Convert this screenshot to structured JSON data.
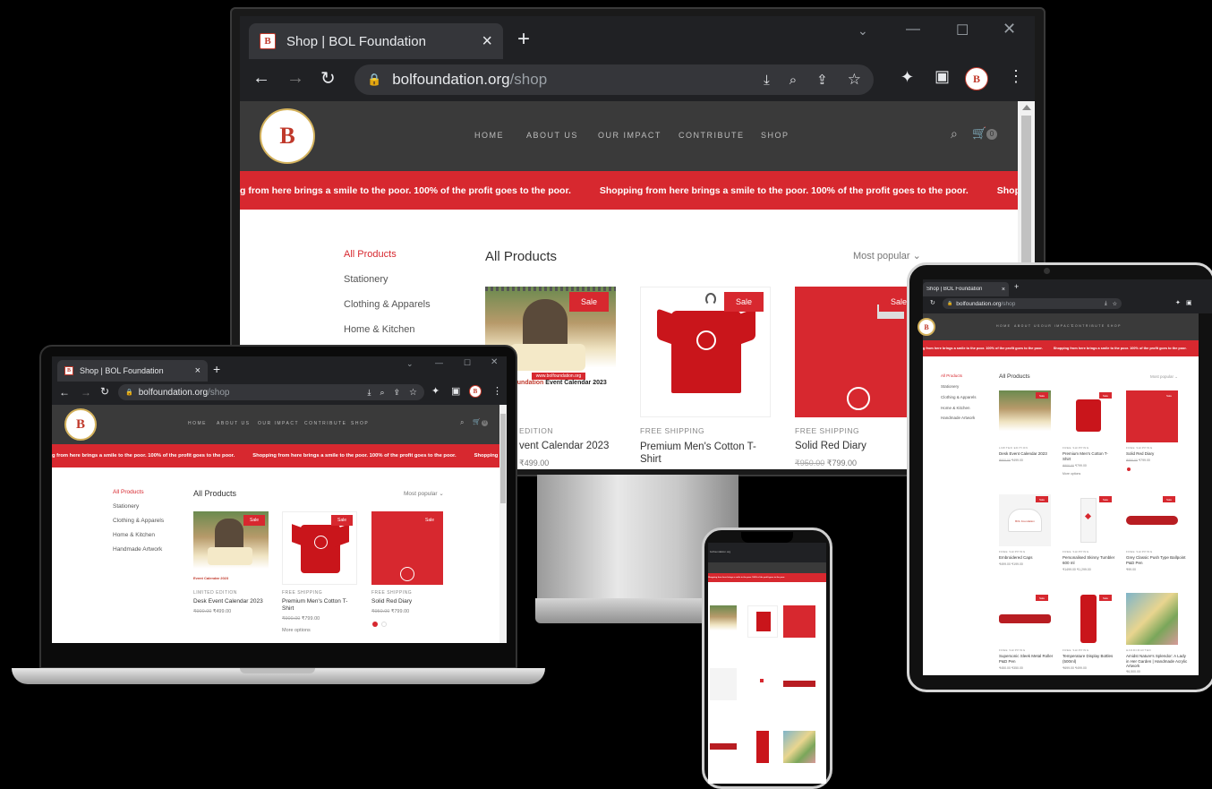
{
  "browser": {
    "tab_title": "Shop | BOL Foundation",
    "url_host": "bolfoundation.org",
    "url_path": "/shop",
    "new_tab": "+",
    "close": "×"
  },
  "site": {
    "logo_letter": "B",
    "nav": [
      "HOME",
      "ABOUT US",
      "OUR IMPACT",
      "CONTRIBUTE",
      "SHOP"
    ],
    "cart_count": "0",
    "banner_text": "Shopping from here brings a smile to the poor. 100% of the profit goes to the poor.",
    "banner_left_fragment": "g from here brings a smile to the poor. 100% of the profit goes to the poor.",
    "banner_right_fragment": "Shopping from h"
  },
  "shop": {
    "categories": [
      "All Products",
      "Stationery",
      "Clothing & Apparels",
      "Home & Kitchen",
      "Handmade Artwork"
    ],
    "heading": "All Products",
    "sort": "Most popular",
    "sale_label": "Sale",
    "products": [
      {
        "tag": "LIMITED EDITION",
        "name": "Desk Event Calendar 2023",
        "old_price": "₹900.00",
        "price": "₹499.00"
      },
      {
        "tag": "FREE SHIPPING",
        "name": "Premium Men's Cotton T-Shirt",
        "old_price": "₹900.00",
        "price": "₹799.00",
        "extra": "More options"
      },
      {
        "tag": "FREE SHIPPING",
        "name": "Solid Red Diary",
        "old_price": "₹950.00",
        "price": "₹799.00"
      }
    ],
    "monitor_tag_fragment": "EDITION",
    "monitor_name_fragment": "vent Calendar 2023",
    "monitor_price_fragment": "₹499.00",
    "monitor_diary_price": "₹799.00",
    "calendar_print": "Event Calendar 2023",
    "calendar_print_prefix": "e (BOL) Foundation",
    "calendar_url_print": "www.bolfoundation.org"
  },
  "tablet": {
    "products_row2": [
      {
        "tag": "FREE SHIPPING",
        "name": "Embroidered Caps",
        "price": "₹499.00 ₹199.00",
        "print": "BOL Foundation"
      },
      {
        "tag": "FREE SHIPPING",
        "name": "Personalised Skinny Tumbler 600 ml",
        "price": "₹1499.00 ₹1,299.00"
      },
      {
        "tag": "FREE SHIPPING",
        "name": "Grey Classic Push Type Ballpoint P&D Pen",
        "price": "₹99.00"
      }
    ],
    "products_row3": [
      {
        "tag": "FREE SHIPPING",
        "name": "Supersonic Sleek Metal Roller P&D Pen",
        "price": "₹450.00 ₹350.00"
      },
      {
        "tag": "FREE SHIPPING",
        "name": "Temperature Display Bottles (500ml)",
        "price": "₹699.00 ₹499.00"
      },
      {
        "tag": "HANDCRAFTED",
        "name": "Amidst Nature's Splendor: A Lady in Her Garden | Handmade Acrylic Artwork",
        "price": "₹6,500.00"
      }
    ]
  },
  "colors": {
    "brand_red": "#d7282f",
    "header_dark": "#3a3a3a",
    "chrome_dark": "#202124"
  }
}
